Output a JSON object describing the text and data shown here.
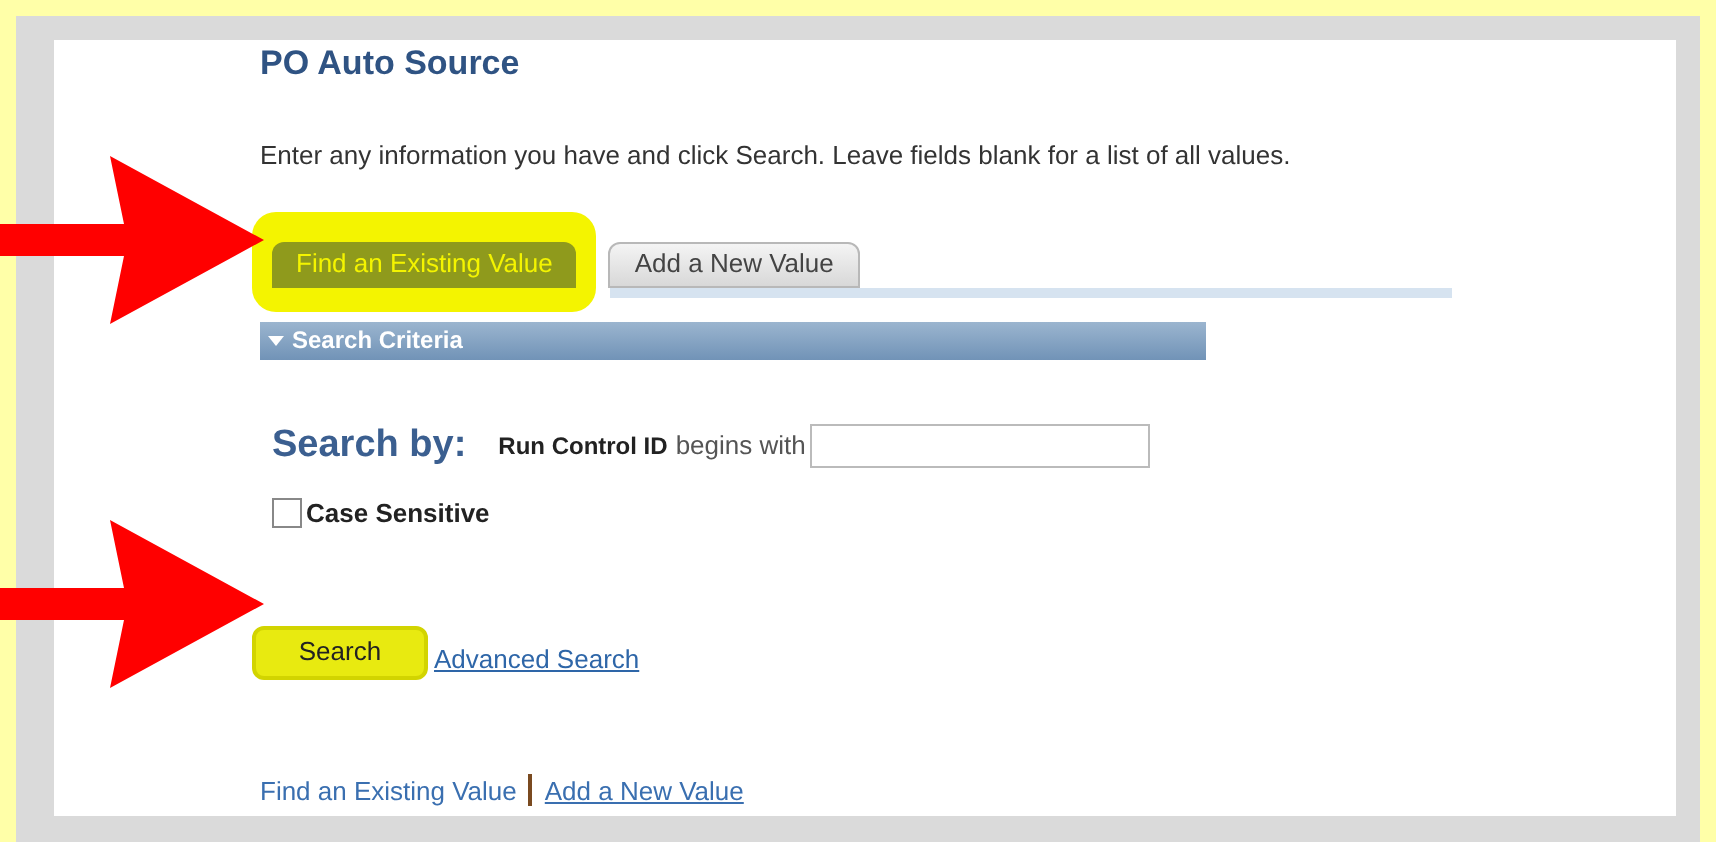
{
  "page_title": "PO Auto Source",
  "instructions": "Enter any information you have and click Search. Leave fields blank for a list of all values.",
  "tabs": [
    {
      "label": "Find an Existing Value",
      "selected": true,
      "highlighted": true
    },
    {
      "label": "Add a New Value",
      "selected": false,
      "highlighted": false
    }
  ],
  "section": {
    "title": "Search Criteria",
    "expanded": true
  },
  "search_by": {
    "label": "Search by:",
    "field_label": "Run Control ID",
    "operator": "begins with"
  },
  "case_sensitive": {
    "label": "Case Sensitive",
    "checked": false
  },
  "actions": [
    {
      "label": "Search",
      "kind": "button",
      "highlighted": true
    },
    {
      "label": "Advanced Search",
      "kind": "link",
      "highlighted": false
    }
  ],
  "footer_links": [
    {
      "label": "Find an Existing Value",
      "kind": "text"
    },
    {
      "label": "Add a New Value",
      "kind": "link"
    }
  ]
}
